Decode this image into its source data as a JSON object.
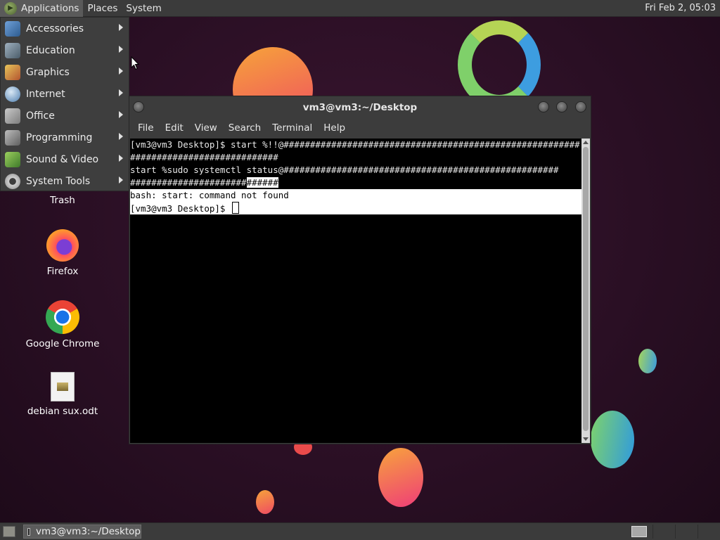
{
  "top_panel": {
    "menus": [
      "Applications",
      "Places",
      "System"
    ],
    "clock": "Fri Feb  2, 05:03"
  },
  "applications_menu": {
    "items": [
      {
        "label": "Accessories",
        "icon": "accessories-icon"
      },
      {
        "label": "Education",
        "icon": "education-icon"
      },
      {
        "label": "Graphics",
        "icon": "graphics-icon"
      },
      {
        "label": "Internet",
        "icon": "internet-globe-icon"
      },
      {
        "label": "Office",
        "icon": "office-icon"
      },
      {
        "label": "Programming",
        "icon": "programming-icon"
      },
      {
        "label": "Sound & Video",
        "icon": "sound-video-icon"
      },
      {
        "label": "System Tools",
        "icon": "system-tools-gear-icon"
      }
    ]
  },
  "desktop": {
    "icons": [
      {
        "label": "Trash",
        "icon": "trash-icon"
      },
      {
        "label": "Firefox",
        "icon": "firefox-icon"
      },
      {
        "label": "Google Chrome",
        "icon": "chrome-icon"
      },
      {
        "label": "debian sux.odt",
        "icon": "document-icon"
      }
    ]
  },
  "terminal": {
    "title": "vm3@vm3:~/Desktop",
    "menus": [
      "File",
      "Edit",
      "View",
      "Search",
      "Terminal",
      "Help"
    ],
    "lines": {
      "l1": "[vm3@vm3 Desktop]$ start %!!@########################################################",
      "l2": "############################",
      "l3": "start %sudo systemctl status@####################################################",
      "l4_sel": "######################",
      "l4_rest": "######",
      "l5": "bash: start: command not found",
      "l6": "[vm3@vm3 Desktop]$ "
    }
  },
  "bottom_panel": {
    "task": "vm3@vm3:~/Desktop"
  },
  "colors": {
    "panel": "#3b3b3b",
    "terminal_bg": "#000000",
    "selection": "#ffffff",
    "wallpaper": "#2a0f24"
  }
}
